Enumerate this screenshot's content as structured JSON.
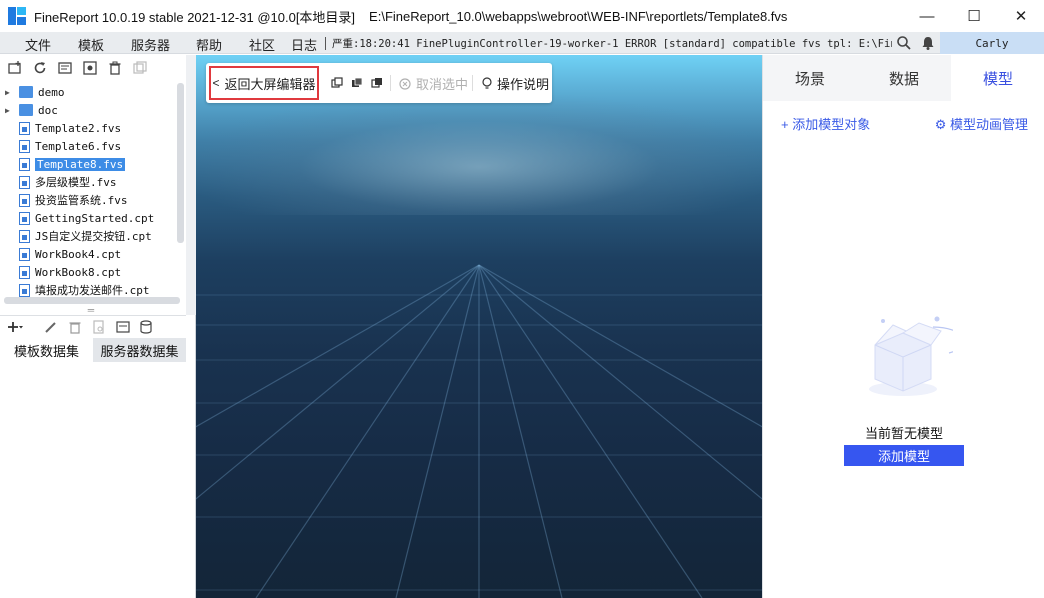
{
  "window": {
    "title": "FineReport 10.0.19 stable 2021-12-31 @10.0[本地目录]",
    "path": "E:\\FineReport_10.0\\webapps\\webroot\\WEB-INF\\reportlets/Template8.fvs",
    "minimize": "—",
    "maximize": "☐",
    "close": "✕"
  },
  "menu": {
    "items": [
      "文件",
      "模板",
      "服务器",
      "帮助",
      "社区"
    ],
    "log_label": "日志",
    "log_text": "严重:18:20:41 FinePluginController-19-worker-1 ERROR [standard] compatible fvs tpl: E:\\Fin...",
    "user": "Carly"
  },
  "file_tree": {
    "items": [
      {
        "label": "demo",
        "type": "folder"
      },
      {
        "label": "doc",
        "type": "folder"
      },
      {
        "label": "Template2.fvs",
        "type": "file"
      },
      {
        "label": "Template6.fvs",
        "type": "file"
      },
      {
        "label": "Template8.fvs",
        "type": "file",
        "selected": true
      },
      {
        "label": "多层级模型.fvs",
        "type": "file"
      },
      {
        "label": "投资监管系统.fvs",
        "type": "file"
      },
      {
        "label": "GettingStarted.cpt",
        "type": "file"
      },
      {
        "label": "JS自定义提交按钮.cpt",
        "type": "file"
      },
      {
        "label": "WorkBook4.cpt",
        "type": "file"
      },
      {
        "label": "WorkBook8.cpt",
        "type": "file"
      },
      {
        "label": "填报成功发送邮件.cpt",
        "type": "file"
      }
    ]
  },
  "dataset": {
    "tabs": [
      "模板数据集",
      "服务器数据集"
    ],
    "active_tab": 0
  },
  "canvas_toolbar": {
    "back_label": "返回大屏编辑器",
    "deselect_label": "取消选中",
    "help_label": "操作说明"
  },
  "right_panel": {
    "tabs": [
      "场景",
      "数据",
      "模型"
    ],
    "active_tab": 2,
    "add_model_object": "+ 添加模型对象",
    "model_animation": "模型动画管理",
    "empty_text": "当前暂无模型",
    "add_model_button": "添加模型"
  },
  "colors": {
    "accent": "#3656f0",
    "link": "#3a5ae6",
    "highlight_border": "#e0393e",
    "selection": "#3d8ce6"
  }
}
